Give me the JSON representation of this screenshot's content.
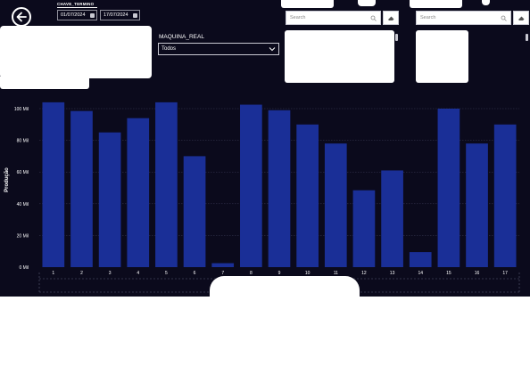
{
  "filters": {
    "date_title": "CHAVE_TERMINO",
    "date_start": "01/07/2024",
    "date_end": "17/07/2024",
    "machine_title": "MAQUINA_REAL",
    "machine_selected": "Todos"
  },
  "search_left": {
    "placeholder": "Search"
  },
  "search_right": {
    "placeholder": "Search"
  },
  "icons": {
    "back": "back-arrow-icon",
    "calendar": "calendar-icon",
    "dropdown": "chevron-down-icon",
    "search": "search-icon",
    "clear": "eraser-icon"
  },
  "colors": {
    "background": "#0b0a1c",
    "bar": "#1a2f97",
    "text": "#ffffff",
    "grid": "#3a3a55"
  },
  "chart_data": {
    "type": "bar",
    "categories": [
      "1",
      "2",
      "3",
      "4",
      "5",
      "6",
      "7",
      "8",
      "9",
      "10",
      "11",
      "12",
      "13",
      "14",
      "15",
      "16",
      "17"
    ],
    "values": [
      104000,
      98500,
      85000,
      94000,
      104000,
      70000,
      2500,
      102500,
      99000,
      90000,
      78000,
      48500,
      61000,
      9500,
      100000,
      78000,
      90000
    ],
    "ylabel": "Produção",
    "ylim": [
      0,
      100000
    ],
    "yticks": [
      0,
      20000,
      40000,
      60000,
      80000,
      100000
    ],
    "ytick_labels": [
      "0 Mil",
      "20 Mil",
      "40 Mil",
      "60 Mil",
      "80 Mil",
      "100 Mil"
    ],
    "grid": true
  }
}
